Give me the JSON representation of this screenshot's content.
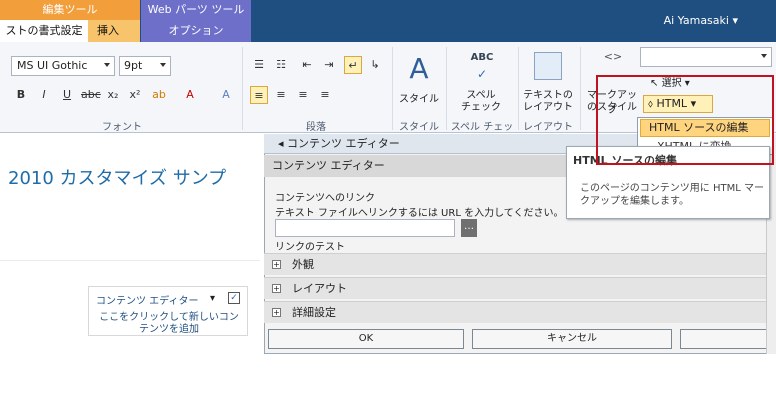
{
  "contextual_tabs": {
    "editing_tools": "編集ツール",
    "web_parts_tools": "Web パーツ ツール"
  },
  "tabs": {
    "format": "ストの書式設定",
    "insert": "挿入",
    "options": "オプション"
  },
  "user": "Ai Yamasaki",
  "ribbon": {
    "font_family": "MS UI Gothic",
    "font_size": "9pt",
    "group_font": "フォント",
    "group_paragraph": "段落",
    "group_styles": "スタイル",
    "group_spelling": "スペル チェック",
    "group_layout": "レイアウト",
    "styles_button": "スタイル",
    "spelling_button_line1": "スペル",
    "spelling_button_line2": "チェック",
    "layout_button_line1": "テキストの",
    "layout_button_line2": "レイアウト",
    "markup_button_line1": "マークアップ",
    "markup_button_line2": "のスタイル",
    "select_button": "選択",
    "html_button": "HTML",
    "abc": "ABC"
  },
  "page": {
    "title": "2010 カスタマイズ サンプ",
    "webpart_title": "コンテンツ エディター",
    "webpart_add": "ここをクリックして新しいコンテンツを追加"
  },
  "panel": {
    "header": "コンテンツ エディター",
    "section": "コンテンツ エディター",
    "link_label": "コンテンツへのリンク",
    "link_hint": "テキスト ファイルへリンクするには URL を入力してください。",
    "link_test": "リンクのテスト",
    "appearance": "外観",
    "layout": "レイアウト",
    "advanced": "詳細設定",
    "ok": "OK",
    "cancel": "キャンセル"
  },
  "menu": {
    "edit_html": "HTML ソースの編集",
    "convert_xhtml": "XHTML に変換"
  },
  "tooltip": {
    "title": "HTML ソースの編集",
    "body": "このページのコンテンツ用に HTML マークアップを編集します。"
  },
  "colors": {
    "ribbon_blue": "#1f4f80",
    "accent_orange": "#f29e3b",
    "highlight_red": "#c0131f"
  }
}
